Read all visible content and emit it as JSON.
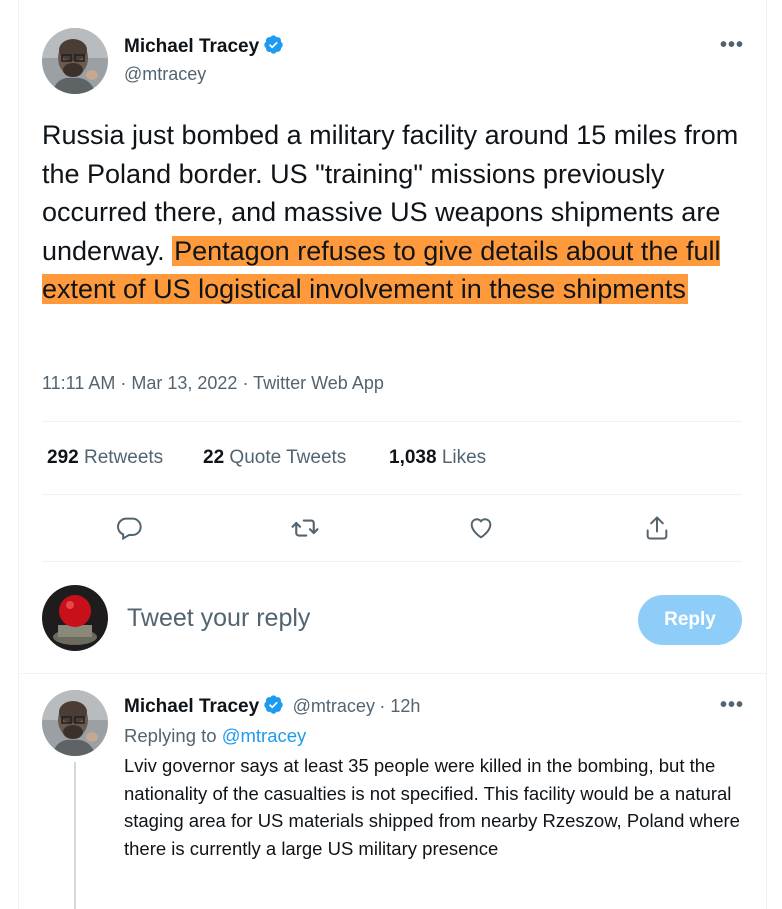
{
  "main_tweet": {
    "author_name": "Michael Tracey",
    "author_handle": "@mtracey",
    "text_plain": "Russia just bombed a military facility around 15 miles from the Poland border. US \"training\" missions previously occurred there, and massive US weapons shipments are underway.",
    "text_highlighted": "Pentagon refuses to give details about the full extent of US logistical involvement in these shipments",
    "timestamp": "11:11 AM · Mar 13, 2022 · Twitter Web App",
    "stats": {
      "retweets_count": "292",
      "retweets_label": "Retweets",
      "quotes_count": "22",
      "quotes_label": "Quote Tweets",
      "likes_count": "1,038",
      "likes_label": "Likes"
    }
  },
  "composer": {
    "placeholder": "Tweet your reply",
    "button_label": "Reply"
  },
  "reply_tweet": {
    "author_name": "Michael Tracey",
    "author_handle": "@mtracey",
    "time": "· 12h",
    "replying_label": "Replying to",
    "replying_handle": "@mtracey",
    "text": "Lviv governor says at least 35 people were killed in the bombing, but the nationality of the casualties is not specified. This facility would be a natural staging area for US materials shipped from nearby Rzeszow, Poland where there is currently a large US military presence"
  },
  "icons": [
    "verified-badge-icon",
    "more-options-icon",
    "reply-icon",
    "retweet-icon",
    "like-icon",
    "share-icon"
  ],
  "colors": {
    "highlight": "#ff9a3c",
    "link": "#1d9bf0",
    "reply_button": "#8ecdf8",
    "secondary_text": "#536471"
  }
}
